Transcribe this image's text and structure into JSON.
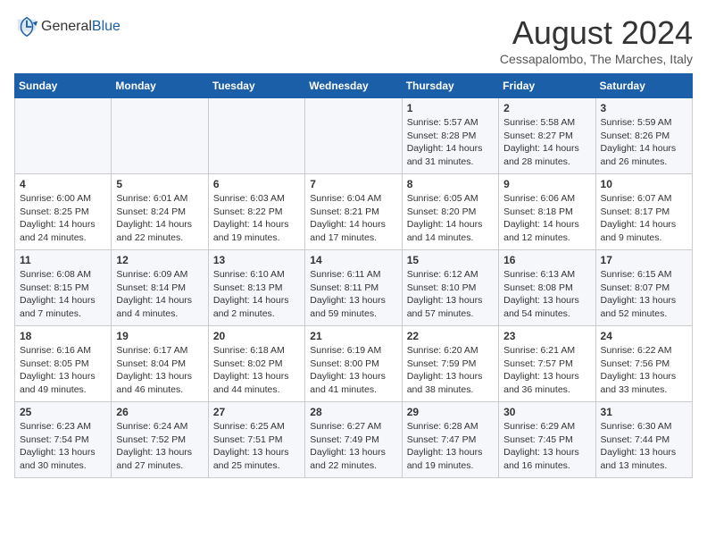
{
  "header": {
    "logo_general": "General",
    "logo_blue": "Blue",
    "month_title": "August 2024",
    "subtitle": "Cessapalombo, The Marches, Italy"
  },
  "weekdays": [
    "Sunday",
    "Monday",
    "Tuesday",
    "Wednesday",
    "Thursday",
    "Friday",
    "Saturday"
  ],
  "weeks": [
    [
      {
        "day": "",
        "info": ""
      },
      {
        "day": "",
        "info": ""
      },
      {
        "day": "",
        "info": ""
      },
      {
        "day": "",
        "info": ""
      },
      {
        "day": "1",
        "info": "Sunrise: 5:57 AM\nSunset: 8:28 PM\nDaylight: 14 hours\nand 31 minutes."
      },
      {
        "day": "2",
        "info": "Sunrise: 5:58 AM\nSunset: 8:27 PM\nDaylight: 14 hours\nand 28 minutes."
      },
      {
        "day": "3",
        "info": "Sunrise: 5:59 AM\nSunset: 8:26 PM\nDaylight: 14 hours\nand 26 minutes."
      }
    ],
    [
      {
        "day": "4",
        "info": "Sunrise: 6:00 AM\nSunset: 8:25 PM\nDaylight: 14 hours\nand 24 minutes."
      },
      {
        "day": "5",
        "info": "Sunrise: 6:01 AM\nSunset: 8:24 PM\nDaylight: 14 hours\nand 22 minutes."
      },
      {
        "day": "6",
        "info": "Sunrise: 6:03 AM\nSunset: 8:22 PM\nDaylight: 14 hours\nand 19 minutes."
      },
      {
        "day": "7",
        "info": "Sunrise: 6:04 AM\nSunset: 8:21 PM\nDaylight: 14 hours\nand 17 minutes."
      },
      {
        "day": "8",
        "info": "Sunrise: 6:05 AM\nSunset: 8:20 PM\nDaylight: 14 hours\nand 14 minutes."
      },
      {
        "day": "9",
        "info": "Sunrise: 6:06 AM\nSunset: 8:18 PM\nDaylight: 14 hours\nand 12 minutes."
      },
      {
        "day": "10",
        "info": "Sunrise: 6:07 AM\nSunset: 8:17 PM\nDaylight: 14 hours\nand 9 minutes."
      }
    ],
    [
      {
        "day": "11",
        "info": "Sunrise: 6:08 AM\nSunset: 8:15 PM\nDaylight: 14 hours\nand 7 minutes."
      },
      {
        "day": "12",
        "info": "Sunrise: 6:09 AM\nSunset: 8:14 PM\nDaylight: 14 hours\nand 4 minutes."
      },
      {
        "day": "13",
        "info": "Sunrise: 6:10 AM\nSunset: 8:13 PM\nDaylight: 14 hours\nand 2 minutes."
      },
      {
        "day": "14",
        "info": "Sunrise: 6:11 AM\nSunset: 8:11 PM\nDaylight: 13 hours\nand 59 minutes."
      },
      {
        "day": "15",
        "info": "Sunrise: 6:12 AM\nSunset: 8:10 PM\nDaylight: 13 hours\nand 57 minutes."
      },
      {
        "day": "16",
        "info": "Sunrise: 6:13 AM\nSunset: 8:08 PM\nDaylight: 13 hours\nand 54 minutes."
      },
      {
        "day": "17",
        "info": "Sunrise: 6:15 AM\nSunset: 8:07 PM\nDaylight: 13 hours\nand 52 minutes."
      }
    ],
    [
      {
        "day": "18",
        "info": "Sunrise: 6:16 AM\nSunset: 8:05 PM\nDaylight: 13 hours\nand 49 minutes."
      },
      {
        "day": "19",
        "info": "Sunrise: 6:17 AM\nSunset: 8:04 PM\nDaylight: 13 hours\nand 46 minutes."
      },
      {
        "day": "20",
        "info": "Sunrise: 6:18 AM\nSunset: 8:02 PM\nDaylight: 13 hours\nand 44 minutes."
      },
      {
        "day": "21",
        "info": "Sunrise: 6:19 AM\nSunset: 8:00 PM\nDaylight: 13 hours\nand 41 minutes."
      },
      {
        "day": "22",
        "info": "Sunrise: 6:20 AM\nSunset: 7:59 PM\nDaylight: 13 hours\nand 38 minutes."
      },
      {
        "day": "23",
        "info": "Sunrise: 6:21 AM\nSunset: 7:57 PM\nDaylight: 13 hours\nand 36 minutes."
      },
      {
        "day": "24",
        "info": "Sunrise: 6:22 AM\nSunset: 7:56 PM\nDaylight: 13 hours\nand 33 minutes."
      }
    ],
    [
      {
        "day": "25",
        "info": "Sunrise: 6:23 AM\nSunset: 7:54 PM\nDaylight: 13 hours\nand 30 minutes."
      },
      {
        "day": "26",
        "info": "Sunrise: 6:24 AM\nSunset: 7:52 PM\nDaylight: 13 hours\nand 27 minutes."
      },
      {
        "day": "27",
        "info": "Sunrise: 6:25 AM\nSunset: 7:51 PM\nDaylight: 13 hours\nand 25 minutes."
      },
      {
        "day": "28",
        "info": "Sunrise: 6:27 AM\nSunset: 7:49 PM\nDaylight: 13 hours\nand 22 minutes."
      },
      {
        "day": "29",
        "info": "Sunrise: 6:28 AM\nSunset: 7:47 PM\nDaylight: 13 hours\nand 19 minutes."
      },
      {
        "day": "30",
        "info": "Sunrise: 6:29 AM\nSunset: 7:45 PM\nDaylight: 13 hours\nand 16 minutes."
      },
      {
        "day": "31",
        "info": "Sunrise: 6:30 AM\nSunset: 7:44 PM\nDaylight: 13 hours\nand 13 minutes."
      }
    ]
  ]
}
